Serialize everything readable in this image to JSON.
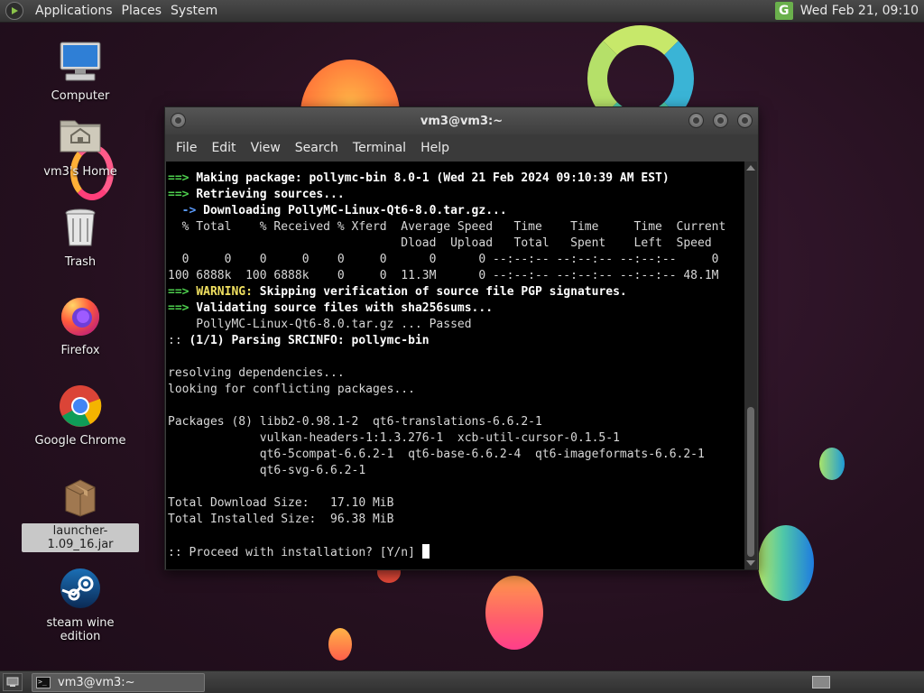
{
  "top_panel": {
    "menus": [
      "Applications",
      "Places",
      "System"
    ],
    "tray_app_letter": "G",
    "clock": "Wed Feb 21, 09:10"
  },
  "desktop_icons": [
    {
      "label": "Computer",
      "icon": "computer-icon"
    },
    {
      "label": "vm3's Home",
      "icon": "home-folder-icon"
    },
    {
      "label": "Trash",
      "icon": "trash-icon"
    },
    {
      "label": "Firefox",
      "icon": "firefox-icon"
    },
    {
      "label": "Google Chrome",
      "icon": "chrome-icon"
    },
    {
      "label": "launcher-1.09_16.jar",
      "icon": "jar-package-icon"
    },
    {
      "label": "steam wine edition",
      "icon": "steam-icon"
    }
  ],
  "terminal": {
    "title": "vm3@vm3:~",
    "menu": [
      "File",
      "Edit",
      "View",
      "Search",
      "Terminal",
      "Help"
    ],
    "lines": [
      {
        "prefix": "==> ",
        "text": "Making package: pollymc-bin 8.0-1 (Wed 21 Feb 2024 09:10:39 AM EST)",
        "style": "arrow-bold"
      },
      {
        "prefix": "==> ",
        "text": "Retrieving sources...",
        "style": "arrow-bold"
      },
      {
        "prefix": "  -> ",
        "text": "Downloading PollyMC-Linux-Qt6-8.0.tar.gz...",
        "style": "subarrow-bold"
      },
      {
        "prefix": "",
        "text": "  % Total    % Received % Xferd  Average Speed   Time    Time     Time  Current",
        "style": "plain"
      },
      {
        "prefix": "",
        "text": "                                 Dload  Upload   Total   Spent    Left  Speed",
        "style": "plain"
      },
      {
        "prefix": "",
        "text": "  0     0    0     0    0     0      0      0 --:--:-- --:--:-- --:--:--     0",
        "style": "plain"
      },
      {
        "prefix": "",
        "text": "100 6888k  100 6888k    0     0  11.3M      0 --:--:-- --:--:-- --:--:-- 48.1M",
        "style": "plain"
      },
      {
        "prefix": "==> ",
        "label": "WARNING:",
        "text": " Skipping verification of source file PGP signatures.",
        "style": "warning"
      },
      {
        "prefix": "==> ",
        "text": "Validating source files with sha256sums...",
        "style": "arrow-bold"
      },
      {
        "prefix": "",
        "text": "    PollyMC-Linux-Qt6-8.0.tar.gz ... Passed",
        "style": "plain"
      },
      {
        "prefix": ":: ",
        "text": "(1/1) Parsing SRCINFO: pollymc-bin",
        "style": "colon-bold"
      },
      {
        "prefix": "",
        "text": "",
        "style": "plain"
      },
      {
        "prefix": "",
        "text": "resolving dependencies...",
        "style": "plain"
      },
      {
        "prefix": "",
        "text": "looking for conflicting packages...",
        "style": "plain"
      },
      {
        "prefix": "",
        "text": "",
        "style": "plain"
      },
      {
        "prefix": "",
        "text": "Packages (8) libb2-0.98.1-2  qt6-translations-6.6.2-1",
        "style": "plain"
      },
      {
        "prefix": "",
        "text": "             vulkan-headers-1:1.3.276-1  xcb-util-cursor-0.1.5-1",
        "style": "plain"
      },
      {
        "prefix": "",
        "text": "             qt6-5compat-6.6.2-1  qt6-base-6.6.2-4  qt6-imageformats-6.6.2-1",
        "style": "plain"
      },
      {
        "prefix": "",
        "text": "             qt6-svg-6.6.2-1",
        "style": "plain"
      },
      {
        "prefix": "",
        "text": "",
        "style": "plain"
      },
      {
        "prefix": "",
        "text": "Total Download Size:   17.10 MiB",
        "style": "plain"
      },
      {
        "prefix": "",
        "text": "Total Installed Size:  96.38 MiB",
        "style": "plain"
      },
      {
        "prefix": "",
        "text": "",
        "style": "plain"
      },
      {
        "prefix": ":: ",
        "text": "Proceed with installation? [Y/n] ",
        "style": "prompt"
      }
    ]
  },
  "taskbar": {
    "window_button": "vm3@vm3:~"
  }
}
